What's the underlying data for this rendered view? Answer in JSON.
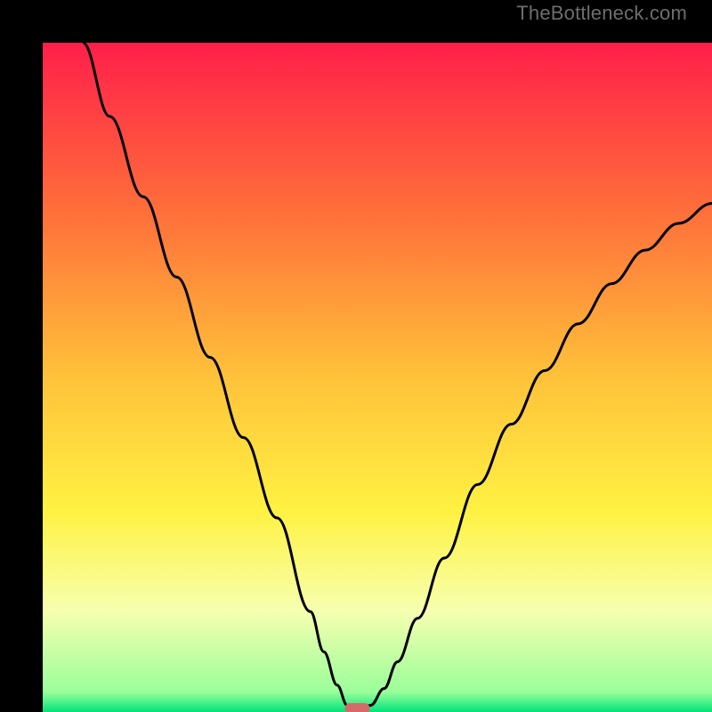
{
  "watermark": "TheBottleneck.com",
  "chart_data": {
    "type": "line",
    "title": "",
    "xlabel": "",
    "ylabel": "",
    "xlim": [
      0,
      1
    ],
    "ylim": [
      0,
      1
    ],
    "grid": false,
    "background": {
      "type": "vertical-gradient",
      "stops": [
        {
          "pos": 0.0,
          "color": "#ff1f4a"
        },
        {
          "pos": 0.25,
          "color": "#ff6e3a"
        },
        {
          "pos": 0.5,
          "color": "#ffc23a"
        },
        {
          "pos": 0.7,
          "color": "#fff242"
        },
        {
          "pos": 0.85,
          "color": "#f6ffb0"
        },
        {
          "pos": 0.97,
          "color": "#9aff9a"
        },
        {
          "pos": 1.0,
          "color": "#00e37a"
        }
      ]
    },
    "series": [
      {
        "name": "bottleneck-curve",
        "color": "#000000",
        "x": [
          0.06,
          0.1,
          0.15,
          0.2,
          0.25,
          0.3,
          0.35,
          0.4,
          0.42,
          0.44,
          0.455,
          0.47,
          0.49,
          0.51,
          0.53,
          0.56,
          0.6,
          0.65,
          0.7,
          0.75,
          0.8,
          0.85,
          0.9,
          0.95,
          1.0
        ],
        "y": [
          1.0,
          0.89,
          0.77,
          0.65,
          0.53,
          0.41,
          0.29,
          0.15,
          0.09,
          0.04,
          0.01,
          0.0,
          0.01,
          0.035,
          0.075,
          0.14,
          0.23,
          0.34,
          0.43,
          0.51,
          0.58,
          0.64,
          0.69,
          0.73,
          0.76
        ]
      }
    ],
    "marker": {
      "name": "minimum-marker",
      "x": 0.47,
      "y": 0.0,
      "color": "#d46a6a"
    }
  }
}
